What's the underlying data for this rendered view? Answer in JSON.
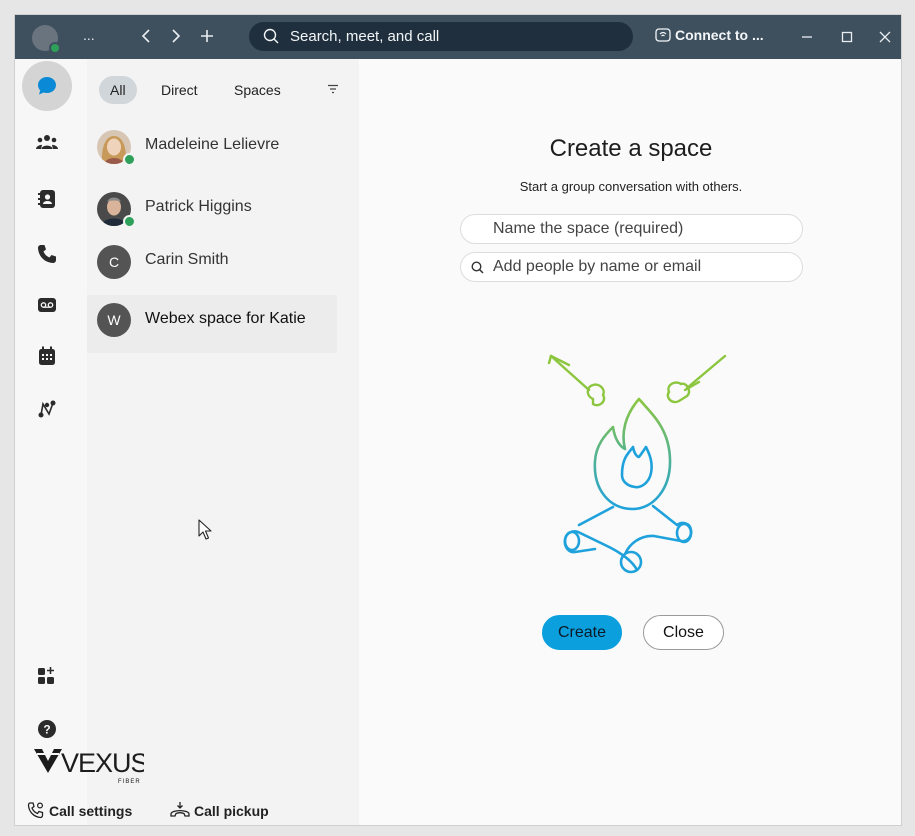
{
  "titlebar": {
    "ellipsis": "...",
    "search_placeholder": "Search, meet, and call",
    "connect_label": "Connect to ...",
    "icons": [
      "back-icon",
      "forward-icon",
      "plus-icon",
      "search-icon",
      "connect-icon",
      "minimize-icon",
      "maximize-icon",
      "close-icon"
    ]
  },
  "rail": {
    "items": [
      {
        "name": "messaging",
        "icon": "chat-bubble-icon",
        "active": true
      },
      {
        "name": "teams",
        "icon": "teams-icon"
      },
      {
        "name": "contacts",
        "icon": "contacts-icon"
      },
      {
        "name": "calling",
        "icon": "phone-icon"
      },
      {
        "name": "voicemail",
        "icon": "voicemail-icon"
      },
      {
        "name": "meetings",
        "icon": "calendar-icon"
      },
      {
        "name": "workflows",
        "icon": "workflow-icon"
      }
    ],
    "bottom": [
      {
        "name": "app-hub",
        "icon": "add-apps-icon"
      },
      {
        "name": "help",
        "icon": "help-icon"
      }
    ]
  },
  "filters": {
    "all": "All",
    "direct": "Direct",
    "spaces": "Spaces"
  },
  "conversations": [
    {
      "name": "Madeleine Lelievre",
      "avatar": "photo",
      "status": "online"
    },
    {
      "name": "Patrick Higgins",
      "avatar": "photo",
      "status": "online"
    },
    {
      "name": "Carin Smith",
      "avatar": "C"
    },
    {
      "name": "Webex space for Katie",
      "avatar": "W",
      "selected": true
    }
  ],
  "logo": {
    "brand": "VEXUS",
    "sub": "FIBER"
  },
  "footer": {
    "call_settings": "Call settings",
    "call_pickup": "Call pickup"
  },
  "create_space": {
    "title": "Create a space",
    "subtitle": "Start a group conversation with others.",
    "name_placeholder": "Name the space (required)",
    "people_placeholder": "Add people by name or email",
    "create_label": "Create",
    "close_label": "Close"
  },
  "colors": {
    "titlebar": "#3e4f5e",
    "accent": "#0ba0dd",
    "online": "#2fa05a",
    "illustration_green": "#8cc63f",
    "illustration_blue": "#1fa2dc"
  }
}
